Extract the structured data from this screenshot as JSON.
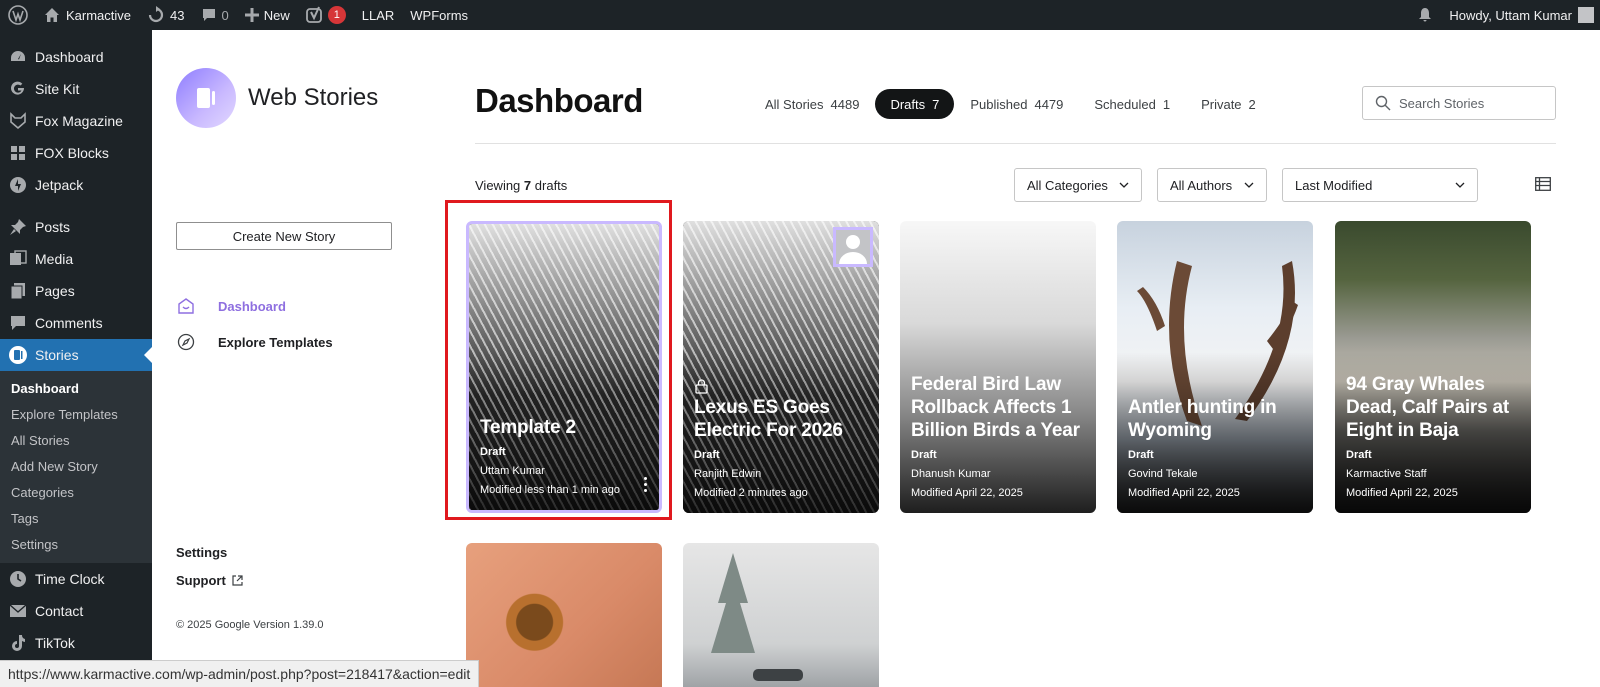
{
  "adminbar": {
    "site_name": "Karmactive",
    "updates_count": "43",
    "comments_count": "0",
    "new_label": "New",
    "yoast_badge": "1",
    "llar_label": "LLAR",
    "wpforms_label": "WPForms",
    "howdy": "Howdy, Uttam Kumar"
  },
  "wpmenu": {
    "items_top": [
      "Dashboard",
      "Site Kit",
      "Fox Magazine",
      "FOX Blocks",
      "Jetpack"
    ],
    "items_mid": [
      "Posts",
      "Media",
      "Pages",
      "Comments"
    ],
    "active": "Stories",
    "submenu": [
      "Dashboard",
      "Explore Templates",
      "All Stories",
      "Add New Story",
      "Categories",
      "Tags",
      "Settings"
    ],
    "items_bottom": [
      "Time Clock",
      "Contact",
      "TikTok"
    ]
  },
  "wsnav": {
    "logo_text": "Web Stories",
    "create_label": "Create New Story",
    "dashboard_label": "Dashboard",
    "explore_label": "Explore Templates",
    "settings_label": "Settings",
    "support_label": "Support",
    "copyright": "© 2025 Google Version 1.39.0"
  },
  "main": {
    "title": "Dashboard",
    "tabs": [
      {
        "label": "All Stories",
        "count": "4489"
      },
      {
        "label": "Drafts",
        "count": "7"
      },
      {
        "label": "Published",
        "count": "4479"
      },
      {
        "label": "Scheduled",
        "count": "1"
      },
      {
        "label": "Private",
        "count": "2"
      }
    ],
    "active_tab": "Drafts",
    "search_placeholder": "Search Stories",
    "viewing_prefix": "Viewing",
    "viewing_count": "7",
    "viewing_suffix": "drafts",
    "filter_categories": "All Categories",
    "filter_authors": "All Authors",
    "sort_order": "Last Modified"
  },
  "cards": [
    {
      "title": "Template 2",
      "status": "Draft",
      "author": "Uttam Kumar",
      "modified": "Modified less than 1 min ago"
    },
    {
      "title": "Lexus ES Goes Electric For 2026",
      "status": "Draft",
      "author": "Ranjith Edwin",
      "modified": "Modified 2 minutes ago"
    },
    {
      "title": "Federal Bird Law Rollback Affects 1 Billion Birds a Year",
      "status": "Draft",
      "author": "Dhanush Kumar",
      "modified": "Modified April 22, 2025"
    },
    {
      "title": "Antler hunting in Wyoming",
      "status": "Draft",
      "author": "Govind Tekale",
      "modified": "Modified April 22, 2025"
    },
    {
      "title": "94 Gray Whales Dead, Calf Pairs at Eight in Baja",
      "status": "Draft",
      "author": "Karmactive Staff",
      "modified": "Modified April 22, 2025"
    }
  ],
  "statusbar_url": "https://www.karmactive.com/wp-admin/post.php?post=218417&action=edit",
  "colors": {
    "wp_dark": "#1d2327",
    "wp_blue": "#2271b1",
    "accent_purple": "#8e6fe0",
    "highlight_red": "#e0191e"
  }
}
